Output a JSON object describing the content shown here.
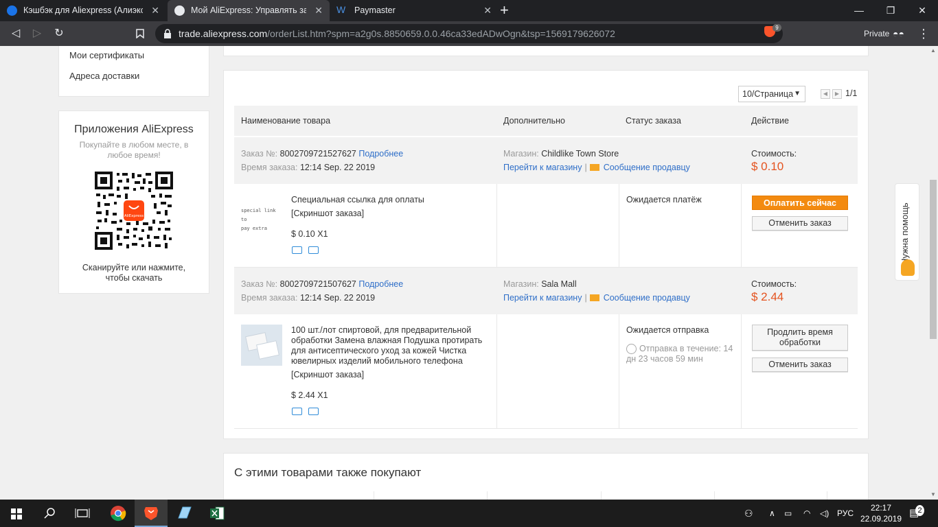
{
  "browser": {
    "tabs": [
      {
        "title": "Кэшбэк для Aliexpress (Алиэкспресс",
        "icon": "cashback-favicon",
        "active": false
      },
      {
        "title": "Мой AliExpress: Управлять заказа",
        "icon": "aliexpress-favicon",
        "active": true
      },
      {
        "title": "Paymaster",
        "icon": "paymaster-favicon",
        "active": false
      }
    ],
    "url_host": "trade.aliexpress.com",
    "url_path": "/orderList.htm?spm=a2g0s.8850659.0.0.46ca33edADwOgn&tsp=1569179626072",
    "shield_count": "9",
    "private_label": "Private"
  },
  "sidebar": {
    "links": [
      "Мои сертификаты",
      "Адреса доставки"
    ],
    "apps_title": "Приложения AliExpress",
    "apps_subtitle_1": "Покупайте в любом месте, в",
    "apps_subtitle_2": "любое время!",
    "qr_brand": "AliExpress",
    "apps_caption_1": "Сканируйте или нажмите,",
    "apps_caption_2": "чтобы скачать"
  },
  "orders_panel": {
    "per_page": "10/Страница",
    "page_count": "1/1",
    "headers": {
      "product": "Наименование товара",
      "extra": "Дополнительно",
      "status": "Статус заказа",
      "action": "Действие"
    },
    "order_no_label": "Заказ №:",
    "order_time_label": "Время заказа:",
    "details_link": "Подробнее",
    "store_label": "Магазин:",
    "go_store_link": "Перейти к магазину",
    "message_seller_link": "Сообщение продавцу",
    "cost_label": "Стоимость:",
    "orders": [
      {
        "number": "8002709721527627",
        "time": "12:14 Sep. 22 2019",
        "store": "Childlike Town Store",
        "price": "$ 0.10",
        "product_name": "Специальная ссылка для оплаты",
        "thumb_text_1": "special link to",
        "thumb_text_2": "pay extra",
        "snapshot": "[Скриншот заказа]",
        "qty_price": "$ 0.10 X1",
        "status": "Ожидается платёж",
        "primary_button": "Оплатить сейчас",
        "secondary_button": "Отменить заказ"
      },
      {
        "number": "8002709721507627",
        "time": "12:14 Sep. 22 2019",
        "store": "Sala Mall",
        "price": "$ 2.44",
        "product_name": "100 шт./лот спиртовой, для предварительной обработки Замена влажная Подушка протирать для антисептического уход за кожей Чистка ювелирных изделий мобильного телефона",
        "snapshot": "[Скриншот заказа]",
        "qty_price": "$ 2.44 X1",
        "status": "Ожидается отправка",
        "status_sub": "Отправка в течение: 14 дн 23 часов 59 мин",
        "primary_button": "Продлить время обработки",
        "secondary_button": "Отменить заказ"
      }
    ]
  },
  "also_bought_title": "С этими товарами также покупают",
  "help_tab": "Нужна помощь",
  "taskbar": {
    "language": "РУС",
    "time": "22:17",
    "date": "22.09.2019",
    "notifications": "2"
  },
  "colors": {
    "accent_orange": "#f38a10",
    "price_red": "#e4531f",
    "link_blue": "#2e6ec8"
  }
}
